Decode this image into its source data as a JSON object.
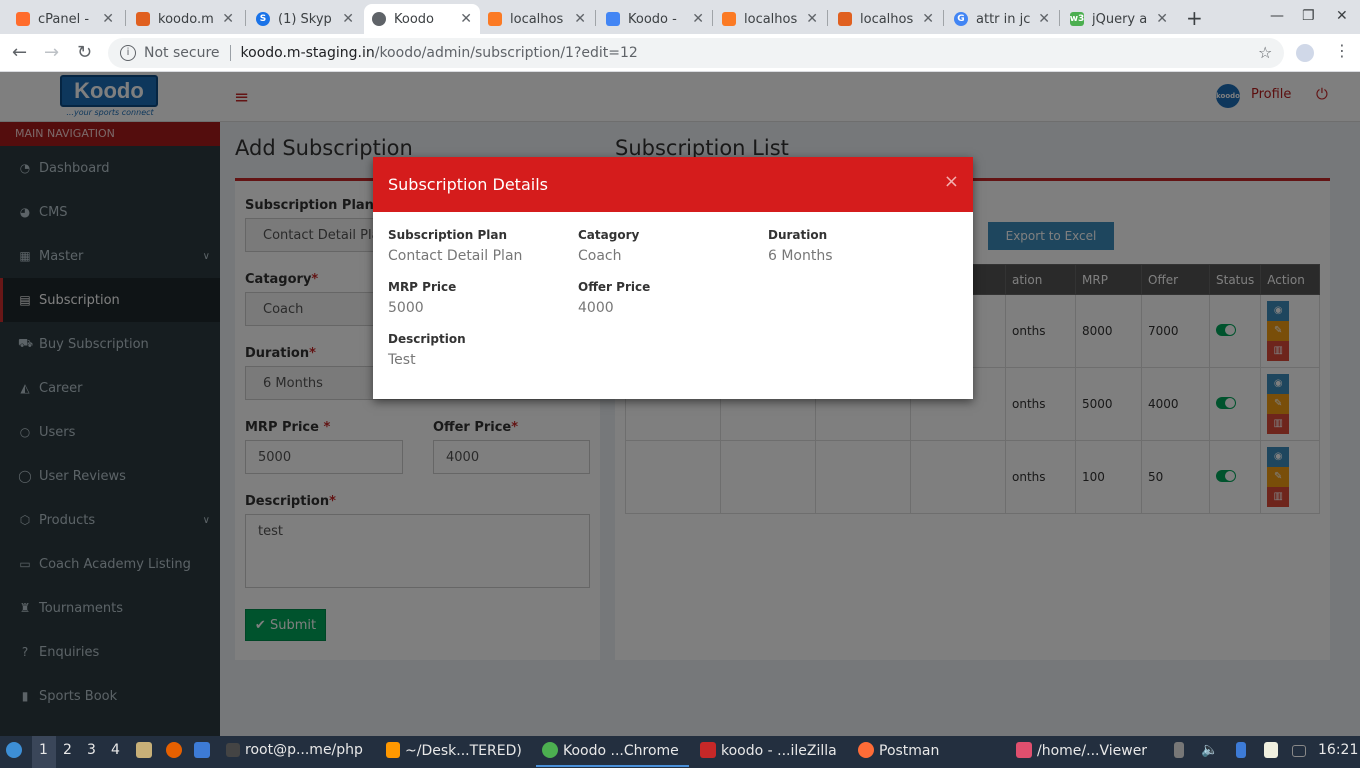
{
  "browser": {
    "tabs": [
      {
        "title": "cPanel -",
        "icon_color": "#ff6c2c",
        "active": false
      },
      {
        "title": "koodo.m",
        "icon_color": "#e06020",
        "active": false
      },
      {
        "title": "(1) Skyp",
        "icon_color": "#1a73e8",
        "active": false
      },
      {
        "title": "Koodo",
        "icon_color": "#5f6368",
        "active": true
      },
      {
        "title": "localhos",
        "icon_color": "#fb7a24",
        "active": false
      },
      {
        "title": "Koodo -",
        "icon_color": "#4285f4",
        "active": false
      },
      {
        "title": "localhos",
        "icon_color": "#fb7a24",
        "active": false
      },
      {
        "title": "localhos",
        "icon_color": "#e06020",
        "active": false
      },
      {
        "title": "attr in jc",
        "icon_color": "#4285f4",
        "active": false
      },
      {
        "title": "jQuery a",
        "icon_color": "#4caf50",
        "active": false
      }
    ],
    "security_label": "Not secure",
    "url_host": "koodo.m-staging.in",
    "url_path": "/koodo/admin/subscription/1?edit=12"
  },
  "header": {
    "logo_text": "Koodo",
    "logo_tagline": "...your sports connect",
    "profile_label": "Profile",
    "brand_color": "#d51c1c"
  },
  "sidebar": {
    "heading": "MAIN NAVIGATION",
    "items": [
      {
        "label": "Dashboard",
        "icon": "dashboard-icon"
      },
      {
        "label": "CMS",
        "icon": "pie-chart-icon"
      },
      {
        "label": "Master",
        "icon": "table-icon"
      },
      {
        "label": "Subscription",
        "icon": "id-card-icon"
      },
      {
        "label": "Buy Subscription",
        "icon": "cart-icon"
      },
      {
        "label": "Career",
        "icon": "graduation-cap-icon"
      },
      {
        "label": "Users",
        "icon": "user-icon"
      },
      {
        "label": "User Reviews",
        "icon": "comment-icon"
      },
      {
        "label": "Products",
        "icon": "cube-icon"
      },
      {
        "label": "Coach Academy Listing",
        "icon": "folder-icon"
      },
      {
        "label": "Tournaments",
        "icon": "trophy-icon"
      },
      {
        "label": "Enquiries",
        "icon": "question-icon"
      },
      {
        "label": "Sports Book",
        "icon": "book-icon"
      }
    ]
  },
  "form": {
    "title": "Add Subscription",
    "plan_label": "Subscription Plan",
    "plan_value": "Contact Detail Plan",
    "category_label": "Catagory",
    "category_value": "Coach",
    "duration_label": "Duration",
    "duration_value": "6 Months",
    "mrp_label": "MRP Price",
    "mrp_value": "5000",
    "offer_label": "Offer Price",
    "offer_value": "4000",
    "description_label": "Description",
    "description_value": "test",
    "required_mark": "*",
    "submit_label": "Submit"
  },
  "list": {
    "title": "Subscription List",
    "export_label": "Export to Excel",
    "columns": [
      "ation",
      "MRP",
      "Offer",
      "Status",
      "Action"
    ],
    "rows": [
      {
        "duration": "onths",
        "mrp": "8000",
        "offer": "7000"
      },
      {
        "duration": "onths",
        "mrp": "5000",
        "offer": "4000"
      },
      {
        "duration": "onths",
        "mrp": "100",
        "offer": "50"
      }
    ]
  },
  "modal": {
    "title": "Subscription Details",
    "close_label": "×",
    "fields": {
      "plan_label": "Subscription Plan",
      "plan_value": "Contact Detail Plan",
      "category_label": "Catagory",
      "category_value": "Coach",
      "duration_label": "Duration",
      "duration_value": "6 Months",
      "mrp_label": "MRP Price",
      "mrp_value": "5000",
      "offer_label": "Offer Price",
      "offer_value": "4000",
      "description_label": "Description",
      "description_value": "Test"
    }
  },
  "taskbar": {
    "workspaces": [
      "1",
      "2",
      "3",
      "4"
    ],
    "terminal": "root@p...me/php",
    "sublime": "~/Desk...TERED)",
    "chrome": "Koodo ...Chrome",
    "filezilla": "koodo - ...ileZilla",
    "postman": "Postman",
    "viewer": "/home/...Viewer",
    "clock": "16:21"
  }
}
